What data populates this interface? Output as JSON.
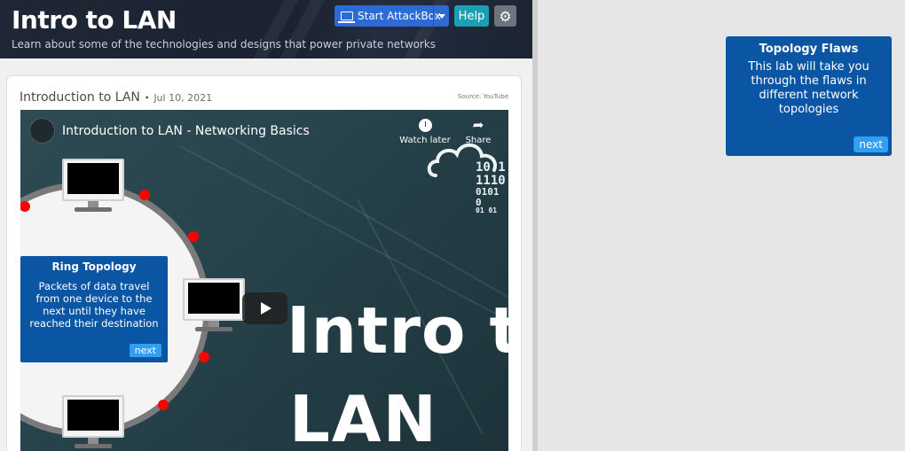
{
  "header": {
    "title": "Intro to LAN",
    "subtitle": "Learn about some of the technologies and designs that power private networks",
    "attackbox_label": "Start AttackBox",
    "help_label": "Help",
    "settings_icon": "gear-icon"
  },
  "task": {
    "title": "Introduction to LAN",
    "separator": "•",
    "date": "Jul 10, 2021",
    "source": "Source: YouTube"
  },
  "video": {
    "channel_avatar_text": "",
    "title": "Introduction to LAN - Networking Basics",
    "watch_later_label": "Watch later",
    "share_label": "Share",
    "big_title_line1": "Intro to",
    "big_title_line2": "LAN",
    "binary_lines": [
      "10 1",
      "1110",
      "0101 0",
      "01 01"
    ]
  },
  "ring_tooltip": {
    "title": "Ring Topology",
    "body": "Packets of data travel from one device to the next until they have reached their destination",
    "next_label": "next"
  },
  "flaws_tooltip": {
    "title": "Topology Flaws",
    "body": "This lab will take you through the flaws in different network topologies",
    "next_label": "next"
  },
  "colors": {
    "tooltip_bg": "#0a56a5",
    "next_button": "#2e9ff2",
    "attackbox_button": "#2a6bd6",
    "help_button": "#1a9fb4",
    "ring_node": "#ff0000"
  }
}
